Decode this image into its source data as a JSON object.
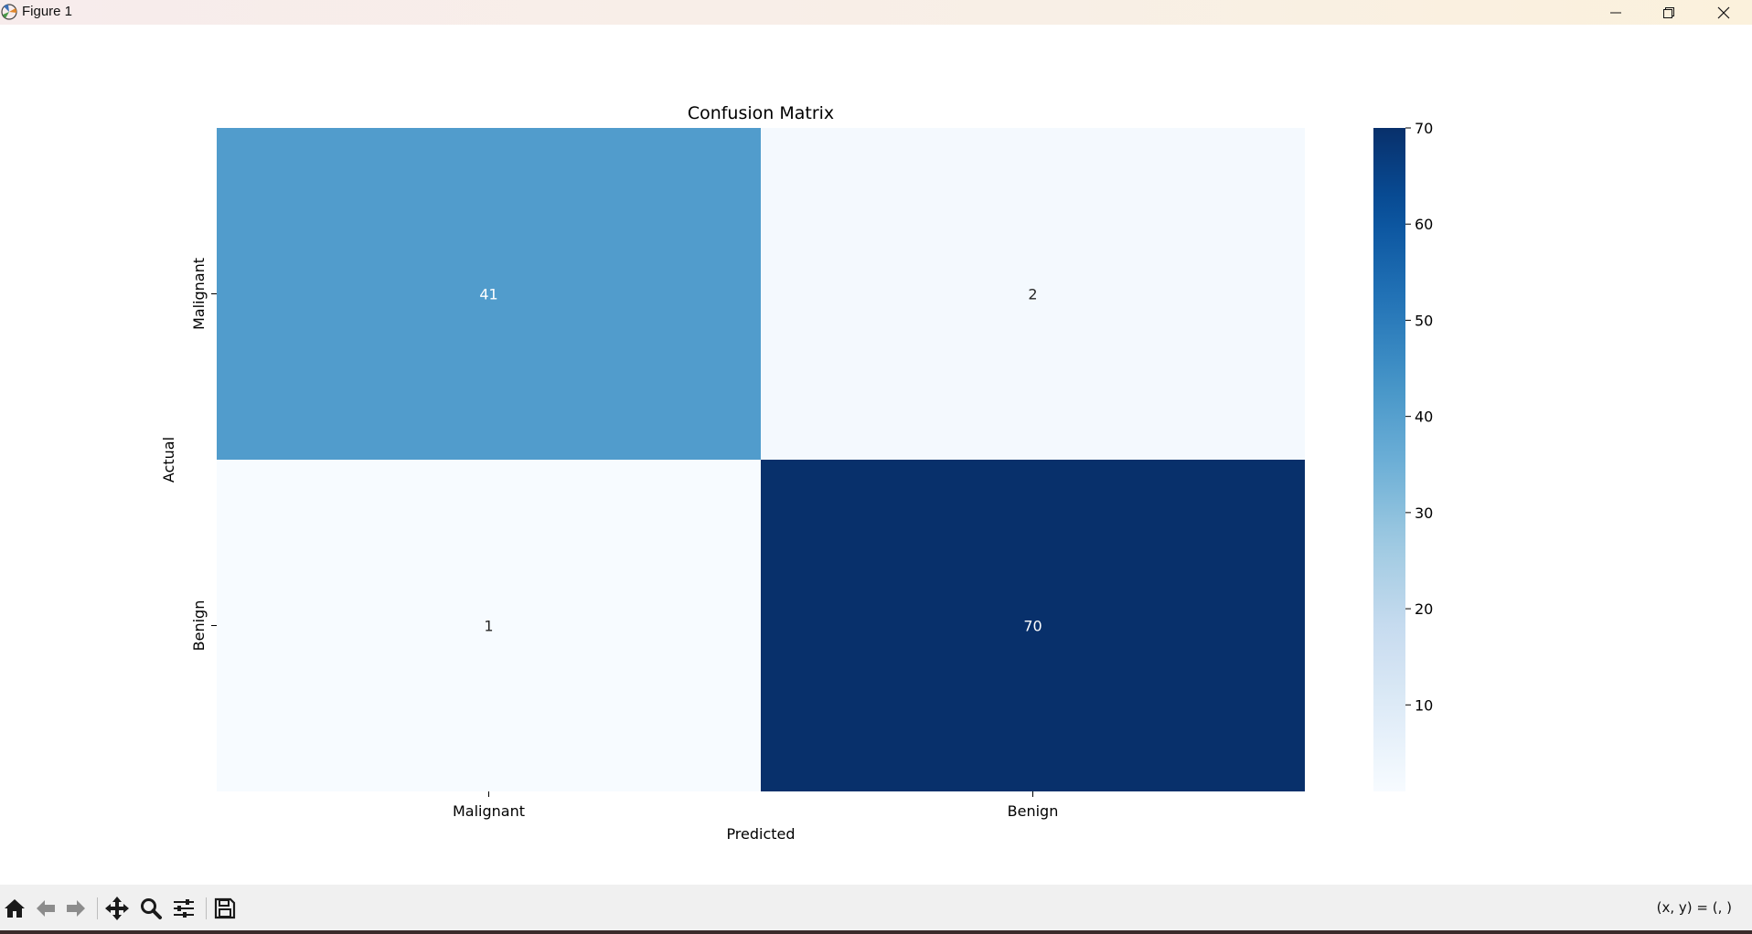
{
  "window": {
    "title": "Figure 1",
    "icons": [
      "matplotlib-logo-icon",
      "minimize-icon",
      "maximize-icon",
      "close-icon"
    ]
  },
  "toolbar": {
    "buttons": [
      "home-icon",
      "back-icon",
      "forward-icon",
      "pan-icon",
      "zoom-icon",
      "configure-subplots-icon",
      "save-icon"
    ],
    "coords_text": "(x, y) = (, )"
  },
  "chart_data": {
    "type": "heatmap",
    "title": "Confusion Matrix",
    "xlabel": "Predicted",
    "ylabel": "Actual",
    "x_categories": [
      "Malignant",
      "Benign"
    ],
    "y_categories": [
      "Malignant",
      "Benign"
    ],
    "values": [
      [
        41,
        2
      ],
      [
        1,
        70
      ]
    ],
    "colormap": "Blues",
    "vmin": 1,
    "vmax": 70,
    "colorbar_ticks": [
      10,
      20,
      30,
      40,
      50,
      60,
      70
    ],
    "annotation_colors": {
      "dark_cells": "#ffffff",
      "light_cells": "#262626"
    }
  }
}
